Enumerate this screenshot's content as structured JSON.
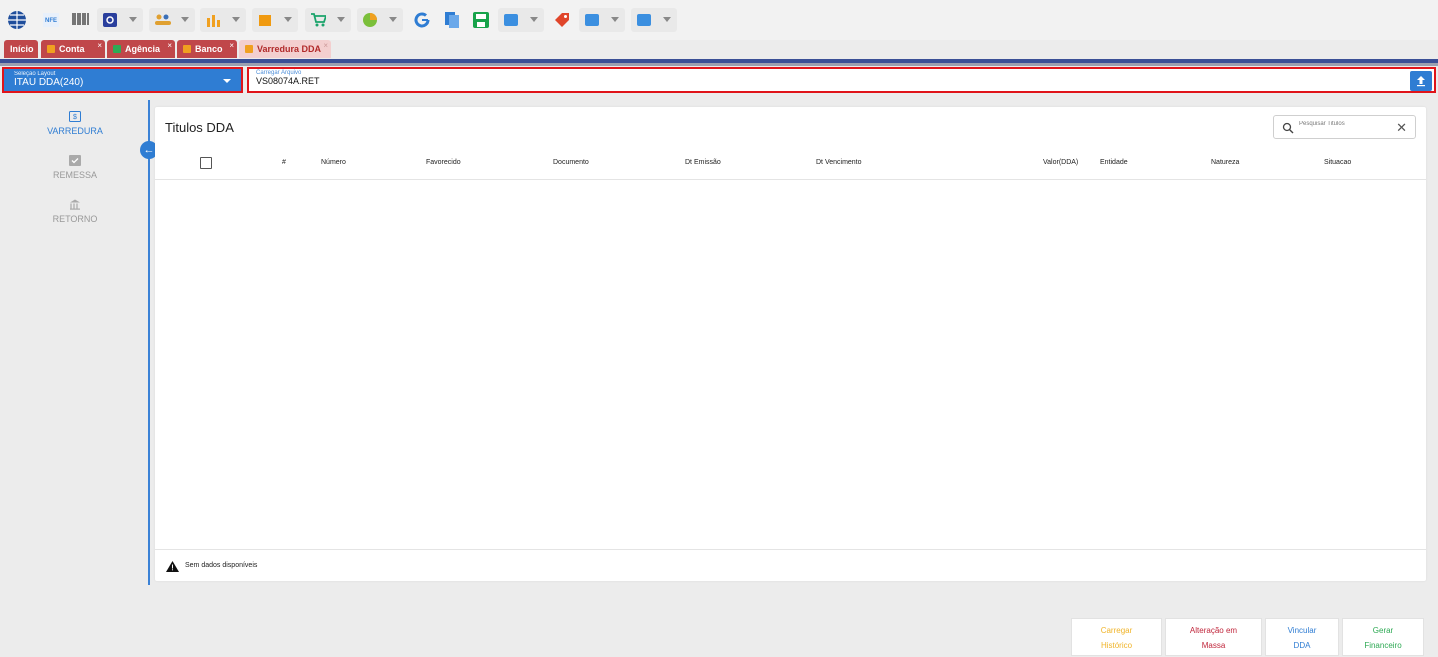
{
  "toolbar": {
    "icons": [
      {
        "name": "app-globe-icon",
        "color": "#1f4e9c"
      },
      {
        "name": "nfe-icon",
        "color": "#2f7dd3"
      },
      {
        "name": "barcode-icon",
        "color": "#333333"
      },
      {
        "name": "settings-icon",
        "color": "#2a3f9d"
      },
      {
        "name": "people-icon",
        "color": "#e0a030"
      },
      {
        "name": "chart-icon",
        "color": "#f0a020"
      },
      {
        "name": "box-icon",
        "color": "#f09a10"
      },
      {
        "name": "cart-icon",
        "color": "#1aa36b"
      },
      {
        "name": "colorful-icon",
        "color": "#7bbf3a"
      },
      {
        "name": "google-icon",
        "color": "#2f7dd3"
      },
      {
        "name": "documents-icon",
        "color": "#2f7dd3"
      },
      {
        "name": "save-icon",
        "color": "#17a34a"
      },
      {
        "name": "module-icon",
        "color": "#3b8fe0"
      },
      {
        "name": "tag-icon",
        "color": "#e0452a"
      },
      {
        "name": "module2-icon",
        "color": "#3b8fe0"
      },
      {
        "name": "module3-icon",
        "color": "#3b8fe0"
      }
    ]
  },
  "tabs": [
    {
      "label": "Início",
      "color": "#c0474a",
      "icon_color": ""
    },
    {
      "label": "Conta",
      "color": "#c0474a",
      "icon_color": "#f0a020"
    },
    {
      "label": "Agência",
      "color": "#c0474a",
      "icon_color": "#2faa55"
    },
    {
      "label": "Banco",
      "color": "#c0474a",
      "icon_color": "#f0a020"
    },
    {
      "label": "Varredura DDA",
      "color": "#f3cfcf",
      "icon_color": "#f0a020"
    }
  ],
  "layout_select": {
    "label": "Seleção Layout",
    "value": "ITAU DDA(240)"
  },
  "file": {
    "label": "Carregar Arquivo",
    "value": "VS08074A.RET"
  },
  "sidebar": {
    "items": [
      {
        "label": "VARREDURA",
        "state": "active"
      },
      {
        "label": "REMESSA",
        "state": "disabled"
      },
      {
        "label": "RETORNO",
        "state": "disabled"
      }
    ]
  },
  "panel": {
    "title": "Titulos DDA",
    "search_placeholder": "Pesquisar Titulos",
    "columns": [
      "#",
      "Número",
      "Favorecido",
      "Documento",
      "Dt Emissão",
      "Dt Vencimento",
      "Valor(DDA)",
      "Entidade",
      "Natureza",
      "Situacao"
    ],
    "rows": [],
    "empty_text": "Sem dados disponíveis"
  },
  "actions": [
    {
      "line1": "Carregar",
      "line2": "Histórico",
      "color": "#f0b429"
    },
    {
      "line1": "Alteração em",
      "line2": "Massa",
      "color": "#c0263b"
    },
    {
      "line1": "Vincular",
      "line2": "DDA",
      "color": "#2f7dd3"
    },
    {
      "line1": "Gerar",
      "line2": "Financeiro",
      "color": "#2faa55"
    }
  ]
}
